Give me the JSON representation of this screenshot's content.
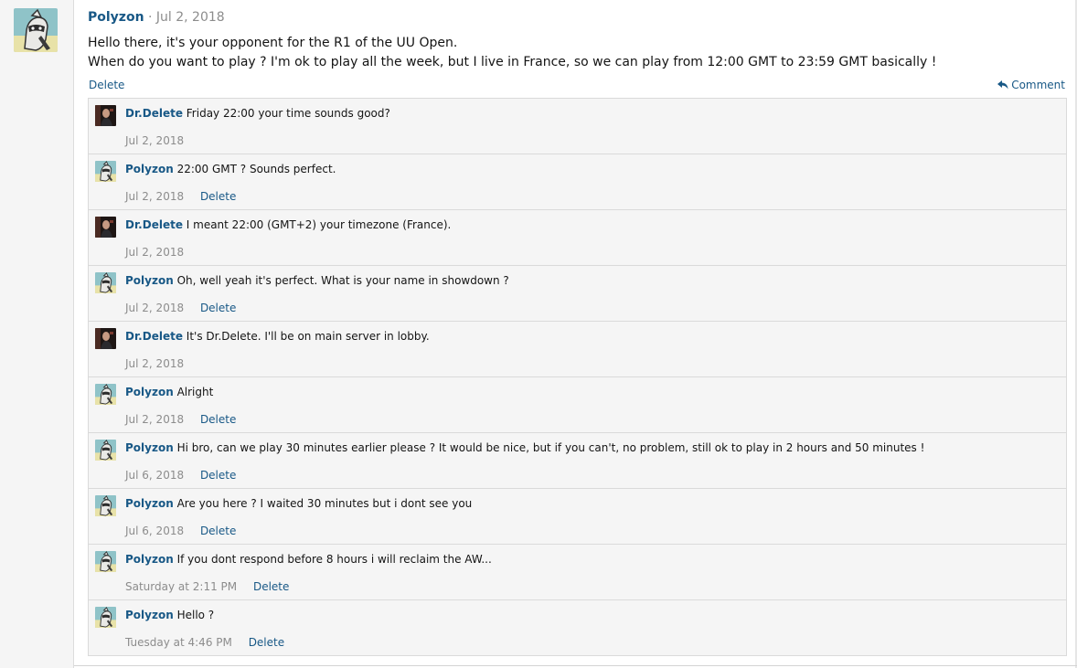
{
  "post": {
    "author": "Polyzon",
    "separator": "·",
    "date": "Jul 2, 2018",
    "body_line1": "Hello there, it's your opponent for the R1 of the UU Open.",
    "body_line2": "When do you want to play ? I'm ok to play all the week, but I live in France, so we can play from 12:00 GMT to 23:59 GMT basically !",
    "delete_label": "Delete",
    "comment_label": "Comment"
  },
  "comments": [
    {
      "author": "Dr.Delete",
      "avatar": "drdelete",
      "text": "Friday 22:00 your time sounds good?",
      "date": "Jul 2, 2018",
      "delete": ""
    },
    {
      "author": "Polyzon",
      "avatar": "polyzon",
      "text": "22:00 GMT ? Sounds perfect.",
      "date": "Jul 2, 2018",
      "delete": "Delete"
    },
    {
      "author": "Dr.Delete",
      "avatar": "drdelete",
      "text": "I meant 22:00 (GMT+2) your timezone (France).",
      "date": "Jul 2, 2018",
      "delete": ""
    },
    {
      "author": "Polyzon",
      "avatar": "polyzon",
      "text": "Oh, well yeah it's perfect. What is your name in showdown ?",
      "date": "Jul 2, 2018",
      "delete": "Delete"
    },
    {
      "author": "Dr.Delete",
      "avatar": "drdelete",
      "text": "It's Dr.Delete. I'll be on main server in lobby.",
      "date": "Jul 2, 2018",
      "delete": ""
    },
    {
      "author": "Polyzon",
      "avatar": "polyzon",
      "text": "Alright",
      "date": "Jul 2, 2018",
      "delete": "Delete"
    },
    {
      "author": "Polyzon",
      "avatar": "polyzon",
      "text": "Hi bro, can we play 30 minutes earlier please ? It would be nice, but if you can't, no problem, still ok to play in 2 hours and 50 minutes !",
      "date": "Jul 6, 2018",
      "delete": "Delete"
    },
    {
      "author": "Polyzon",
      "avatar": "polyzon",
      "text": "Are you here ? I waited 30 minutes but i dont see you",
      "date": "Jul 6, 2018",
      "delete": "Delete"
    },
    {
      "author": "Polyzon",
      "avatar": "polyzon",
      "text": "If you dont respond before 8 hours i will reclaim the AW...",
      "date": "Saturday at 2:11 PM",
      "delete": "Delete"
    },
    {
      "author": "Polyzon",
      "avatar": "polyzon",
      "text": "Hello ?",
      "date": "Tuesday at 4:46 PM",
      "delete": "Delete"
    }
  ],
  "colors": {
    "link": "#185886",
    "muted": "#8c8c8c",
    "comment_bg": "#f5f5f5",
    "border": "#dadada"
  }
}
